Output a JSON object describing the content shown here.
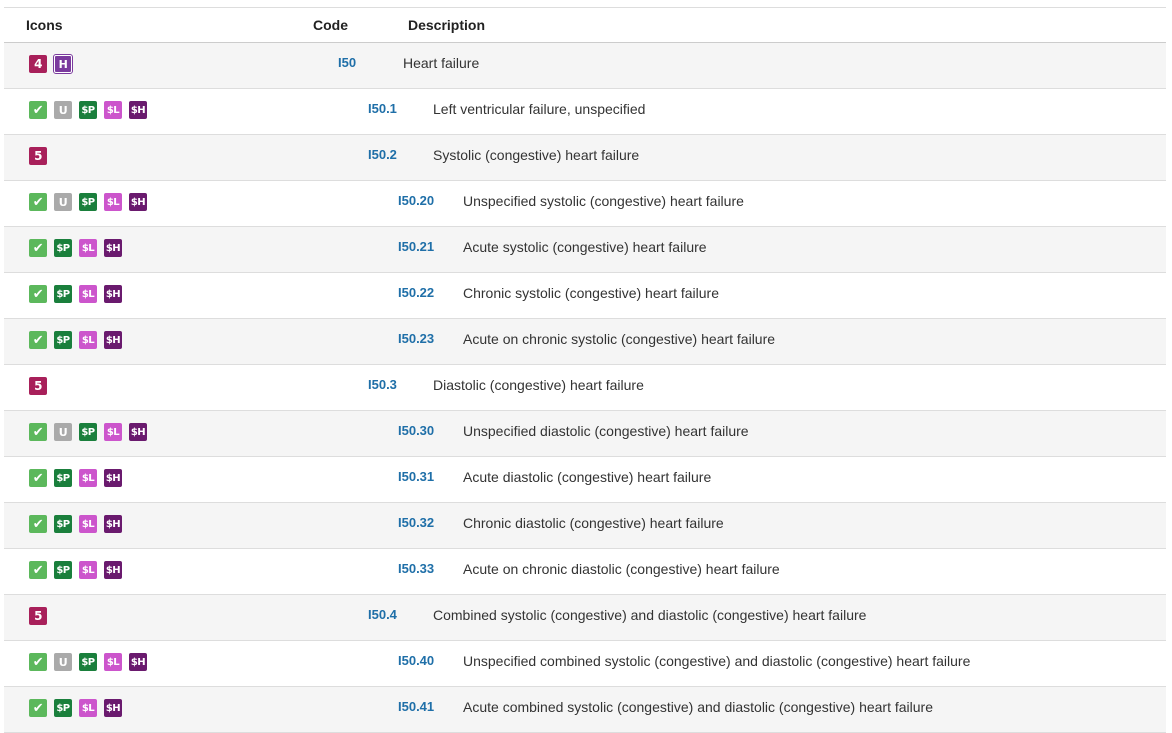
{
  "header": {
    "icons_label": "Icons",
    "code_label": "Code",
    "description_label": "Description"
  },
  "colors": {
    "code_link": "#1f6fa8",
    "billable_check": "#5cb85c",
    "unacceptable_u": "#aaaaaa",
    "sp": "#1a7f3c",
    "sl": "#cc55cc",
    "sh": "#6a1a6e",
    "level_badge": "#a8205a",
    "h_badge": "#7b3b9e"
  },
  "badge_text": {
    "check": "✔",
    "u": "U",
    "sp": "$P",
    "sl": "$L",
    "sh": "$H",
    "h": "H"
  },
  "rows": [
    {
      "code": "I50",
      "description": "Heart failure",
      "depth": 0,
      "icons": [
        "4",
        "h"
      ]
    },
    {
      "code": "I50.1",
      "description": "Left ventricular failure, unspecified",
      "depth": 1,
      "icons": [
        "check",
        "u",
        "sp",
        "sl",
        "sh"
      ]
    },
    {
      "code": "I50.2",
      "description": "Systolic (congestive) heart failure",
      "depth": 1,
      "icons": [
        "5"
      ]
    },
    {
      "code": "I50.20",
      "description": "Unspecified systolic (congestive) heart failure",
      "depth": 2,
      "icons": [
        "check",
        "u",
        "sp",
        "sl",
        "sh"
      ]
    },
    {
      "code": "I50.21",
      "description": "Acute systolic (congestive) heart failure",
      "depth": 2,
      "icons": [
        "check",
        "sp",
        "sl",
        "sh"
      ]
    },
    {
      "code": "I50.22",
      "description": "Chronic systolic (congestive) heart failure",
      "depth": 2,
      "icons": [
        "check",
        "sp",
        "sl",
        "sh"
      ]
    },
    {
      "code": "I50.23",
      "description": "Acute on chronic systolic (congestive) heart failure",
      "depth": 2,
      "icons": [
        "check",
        "sp",
        "sl",
        "sh"
      ]
    },
    {
      "code": "I50.3",
      "description": "Diastolic (congestive) heart failure",
      "depth": 1,
      "icons": [
        "5"
      ]
    },
    {
      "code": "I50.30",
      "description": "Unspecified diastolic (congestive) heart failure",
      "depth": 2,
      "icons": [
        "check",
        "u",
        "sp",
        "sl",
        "sh"
      ]
    },
    {
      "code": "I50.31",
      "description": "Acute diastolic (congestive) heart failure",
      "depth": 2,
      "icons": [
        "check",
        "sp",
        "sl",
        "sh"
      ]
    },
    {
      "code": "I50.32",
      "description": "Chronic diastolic (congestive) heart failure",
      "depth": 2,
      "icons": [
        "check",
        "sp",
        "sl",
        "sh"
      ]
    },
    {
      "code": "I50.33",
      "description": "Acute on chronic diastolic (congestive) heart failure",
      "depth": 2,
      "icons": [
        "check",
        "sp",
        "sl",
        "sh"
      ]
    },
    {
      "code": "I50.4",
      "description": "Combined systolic (congestive) and diastolic (congestive) heart failure",
      "depth": 1,
      "icons": [
        "5"
      ]
    },
    {
      "code": "I50.40",
      "description": "Unspecified combined systolic (congestive) and diastolic (congestive) heart failure",
      "depth": 2,
      "icons": [
        "check",
        "u",
        "sp",
        "sl",
        "sh"
      ]
    },
    {
      "code": "I50.41",
      "description": "Acute combined systolic (congestive) and diastolic (congestive) heart failure",
      "depth": 2,
      "icons": [
        "check",
        "sp",
        "sl",
        "sh"
      ]
    }
  ]
}
